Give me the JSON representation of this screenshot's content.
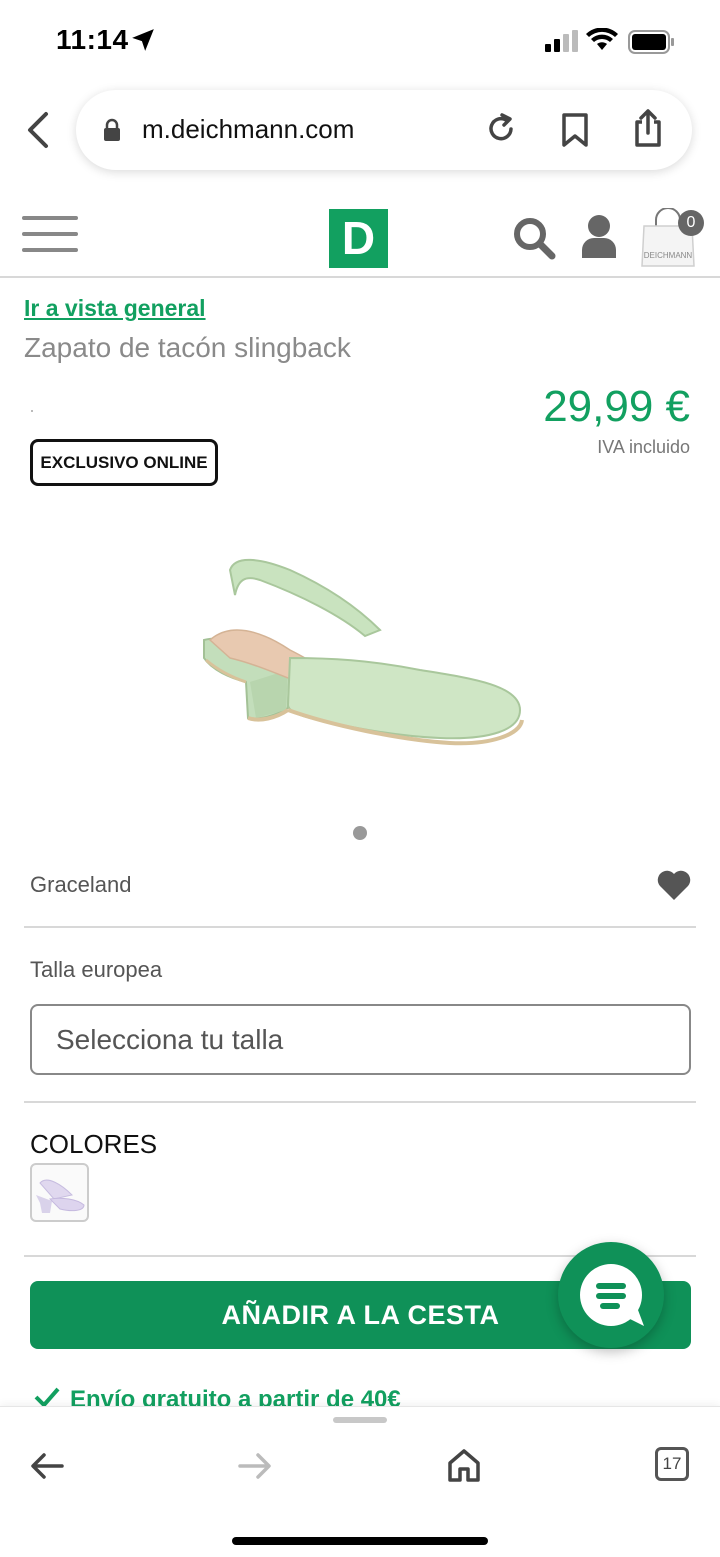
{
  "status_bar": {
    "time": "11:14"
  },
  "browser": {
    "url": "m.deichmann.com",
    "tabs_count": "17"
  },
  "header": {
    "logo_letter": "D",
    "cart_count": "0",
    "bag_text": "DEICHMANN"
  },
  "product": {
    "breadcrumb": "Ir a vista general",
    "title": "Zapato de tacón slingback",
    "price": "29,99 €",
    "vat_note": "IVA incluido",
    "badge": "EXCLUSIVO ONLINE",
    "brand": "Graceland",
    "size_label": "Talla europea",
    "size_placeholder": "Selecciona tu talla",
    "colors_label": "COLORES",
    "add_to_cart": "AÑADIR A LA CESTA",
    "shipping_note": "Envío gratuito a partir de 40€"
  },
  "colors": {
    "accent": "#12a060",
    "button": "#0f9158",
    "shoe": "#c7e0bd"
  },
  "icons": [
    "location-arrow-icon",
    "signal-icon",
    "wifi-icon",
    "battery-icon",
    "back-chevron-icon",
    "lock-icon",
    "reload-icon",
    "bookmark-icon",
    "share-icon",
    "hamburger-menu-icon",
    "search-icon",
    "user-icon",
    "shopping-bag-icon",
    "heart-icon",
    "chat-icon",
    "check-icon",
    "back-arrow-icon",
    "forward-arrow-icon",
    "home-icon",
    "tabs-icon"
  ]
}
